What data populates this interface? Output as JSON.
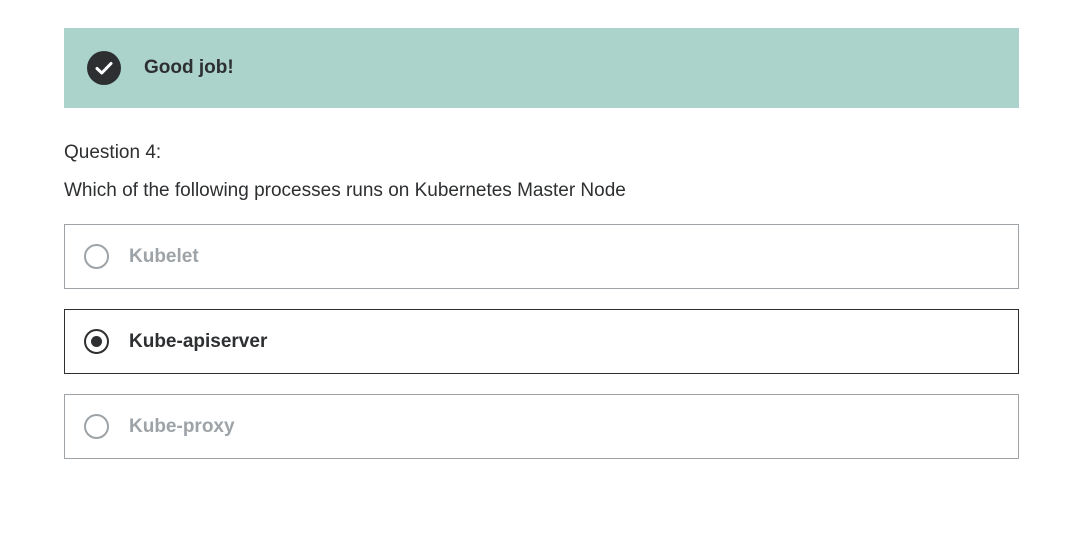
{
  "feedback": {
    "message": "Good job!",
    "icon": "check-circle-icon",
    "background_color": "#acd2cc"
  },
  "question": {
    "number_label": "Question 4:",
    "text": "Which of the following processes runs on Kubernetes Master Node",
    "options": [
      {
        "label": "Kubelet",
        "selected": false
      },
      {
        "label": "Kube-apiserver",
        "selected": true
      },
      {
        "label": "Kube-proxy",
        "selected": false
      }
    ]
  },
  "colors": {
    "text_primary": "#2d2f31",
    "text_muted": "#9da3a7"
  }
}
